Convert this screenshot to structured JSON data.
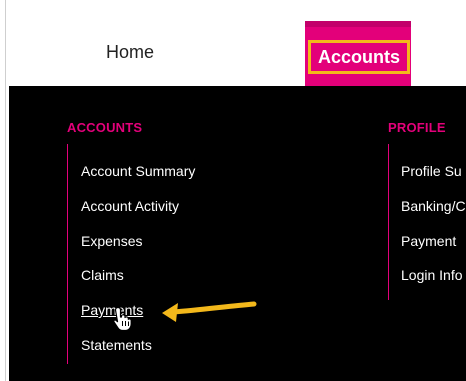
{
  "topnav": {
    "home_label": "Home",
    "accounts_label": "Accounts"
  },
  "dropdown": {
    "accounts_section": {
      "heading": "ACCOUNTS",
      "items": [
        "Account Summary",
        "Account Activity",
        "Expenses",
        "Claims",
        "Payments",
        "Statements"
      ]
    },
    "profile_section": {
      "heading": "PROFILE",
      "items": [
        "Profile Su",
        "Banking/C",
        "Payment",
        "Login Info"
      ]
    }
  },
  "annotation": {
    "arrow_color": "#f3b81b",
    "cursor_icon": "hand-pointer-icon"
  },
  "colors": {
    "brand": "#e3007a",
    "highlight": "#f3b81b",
    "menu_bg": "#000000"
  }
}
